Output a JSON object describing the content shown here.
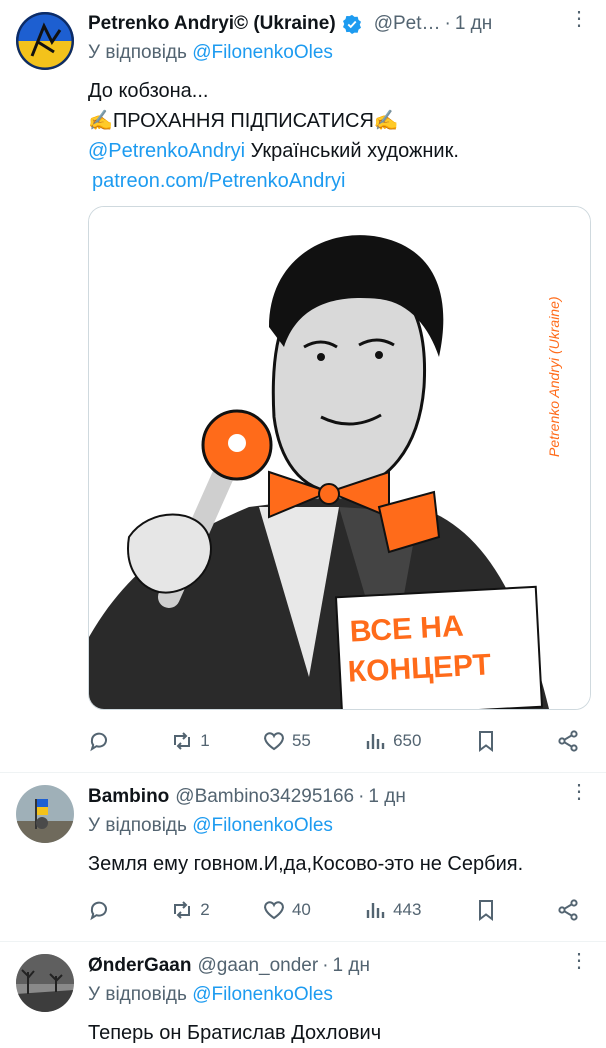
{
  "tweets": [
    {
      "name": "Petrenko Andryi© (Ukraine)",
      "handle": "@Pet…",
      "time": "1 дн",
      "reply_prefix": "У відповідь ",
      "reply_mention": "@FilonenkoOles",
      "lines": [
        "До кобзона...",
        "✍️ПРОХАННЯ ПІДПИСАТИСЯ✍️"
      ],
      "mention": "@PetrenkoAndryi",
      "mention_suffix": " Український художник.",
      "link": "patreon.com/PetrenkoAndryi",
      "media_signature": "Petrenko Andryi (Ukraine)",
      "poster_text": [
        "ВСЕ НА",
        "КОНЦЕРТ"
      ],
      "stats": {
        "replies": "",
        "retweets": "1",
        "likes": "55",
        "views": "650"
      }
    },
    {
      "name": "Bambino",
      "handle": "@Bambino34295166",
      "time": "1 дн",
      "reply_prefix": "У відповідь ",
      "reply_mention": "@FilonenkoOles",
      "text": "Земля ему говном.И,да,Косово-это не Сербия.",
      "stats": {
        "replies": "",
        "retweets": "2",
        "likes": "40",
        "views": "443"
      }
    },
    {
      "name": "ØnderGaan",
      "handle": "@gaan_onder",
      "time": "1 дн",
      "reply_prefix": "У відповідь ",
      "reply_mention": "@FilonenkoOles",
      "text": "Теперь он Братислав Дохлович"
    }
  ],
  "colors": {
    "accent": "#1d9bf0",
    "muted": "#536471",
    "orange": "#ff6b1a"
  }
}
